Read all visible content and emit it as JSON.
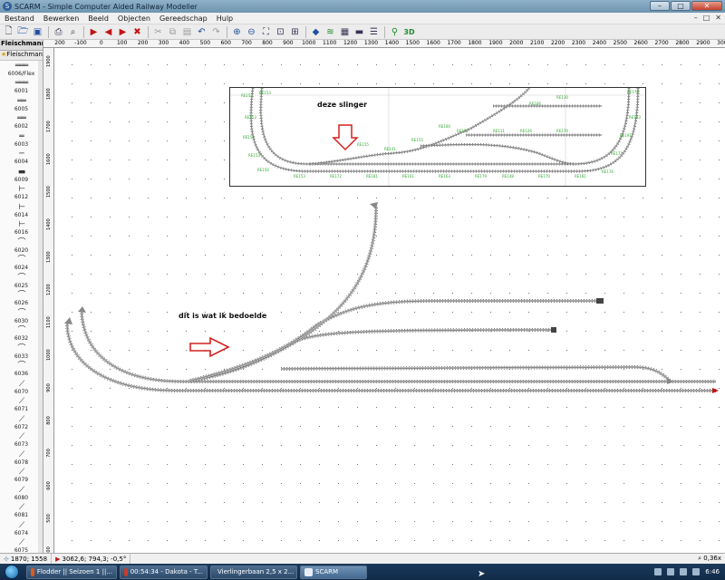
{
  "window": {
    "title": "SCARM - Simple Computer Aided Railway Modeller",
    "minimize": "–",
    "maximize": "□",
    "close": "✕"
  },
  "menubar": {
    "items": [
      "Bestand",
      "Bewerken",
      "Beeld",
      "Objecten",
      "Gereedschap",
      "Hulp"
    ],
    "mdi": [
      "–",
      "□",
      "✕"
    ]
  },
  "toolbar": {
    "icons": [
      "new-file-icon",
      "open-folder-icon",
      "save-icon",
      "print-icon",
      "print-preview-icon",
      "play-icon",
      "play-back-icon",
      "play-forward-icon",
      "delete-icon",
      "cut-icon",
      "copy-icon",
      "paste-icon",
      "undo-icon",
      "redo-icon",
      "zoom-in-icon",
      "zoom-out-icon",
      "zoom-fit-icon",
      "zoom-window-icon",
      "zoom-100-icon",
      "layers-icon",
      "layer-stack-icon",
      "grid-icon",
      "ruler-icon",
      "bars-icon",
      "track-tool-icon",
      "view-3d-icon"
    ],
    "view_3d": "3D"
  },
  "library": {
    "manufacturer": "Fleischmann",
    "dropdown_arrow": "▾",
    "favorite_label": "Fleischmann-",
    "first_item": "6006/Flex",
    "items": [
      "6001",
      "6005",
      "6002",
      "6003",
      "6004",
      "6009",
      "6012",
      "6014",
      "6016",
      "6020",
      "6024",
      "6025",
      "6026",
      "6030",
      "6032",
      "6033",
      "6036",
      "6070",
      "6071",
      "6072",
      "6073",
      "6078",
      "6079",
      "6080",
      "6081",
      "6074",
      "6075"
    ]
  },
  "ruler": {
    "top": [
      "200",
      "-100",
      "0",
      "100",
      "200",
      "300",
      "400",
      "500",
      "600",
      "700",
      "800",
      "900",
      "1000",
      "1100",
      "1200",
      "1300",
      "1400",
      "1500",
      "1600",
      "1700",
      "1800",
      "1900",
      "2000",
      "2100",
      "2200",
      "2300",
      "2400",
      "2500",
      "2600",
      "2700",
      "2800",
      "2900",
      "3000",
      "310"
    ],
    "left": [
      "1900",
      "1800",
      "1700",
      "1600",
      "1500",
      "1400",
      "1300",
      "1200",
      "1100",
      "1000",
      "900",
      "800",
      "700",
      "600",
      "500",
      "400"
    ]
  },
  "canvas": {
    "embed_label": "deze slinger",
    "annotation": "dit is wat ik bedoelde",
    "track_labels": [
      "RE153",
      "RE153",
      "RE153",
      "RE153",
      "RE153",
      "RE150",
      "RE153",
      "RE172",
      "RE181",
      "RE161",
      "RE163",
      "RE179",
      "RE148",
      "RE170",
      "RE181",
      "RE176",
      "RE177",
      "RE191",
      "RE193",
      "RE178",
      "RE160",
      "RE155",
      "RE155",
      "RE141",
      "RE151",
      "RE111",
      "RE126",
      "RE170",
      "RE166",
      "RE130"
    ]
  },
  "statusbar": {
    "coords": "1870; 1558",
    "position": "3062,6; 794,3; -0,5°",
    "zoom": "0,36x"
  },
  "taskbar": {
    "tasks": [
      "Flodder || Seizoen 1 ||...",
      "00:54:34 - Dakota - T...",
      "Vierlingerbaan 2,5 x 2...",
      "SCARM"
    ],
    "time": "6:46"
  },
  "colors": {
    "arrow": "#d42020",
    "track_tie": "#333333",
    "embed_labels": "#36a836"
  }
}
